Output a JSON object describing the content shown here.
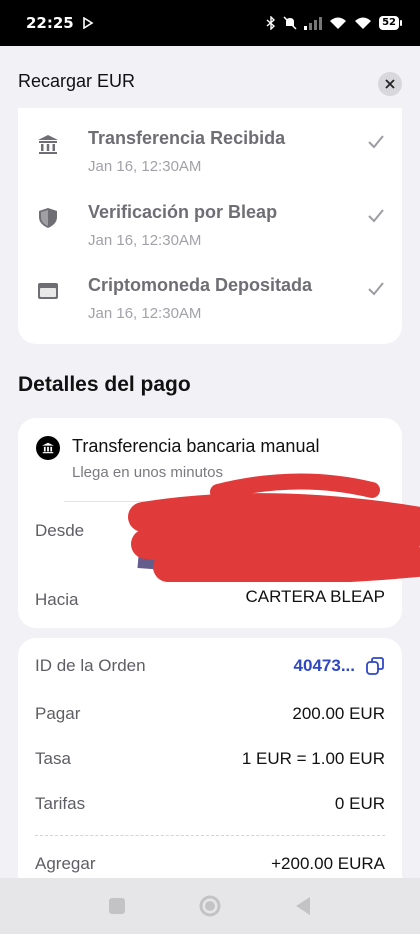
{
  "status_bar": {
    "time": "22:25",
    "battery": "52"
  },
  "header": {
    "title": "Recargar EUR"
  },
  "steps": [
    {
      "title": "Transferencia Recibida",
      "time": "Jan 16, 12:30AM",
      "icon": "bank-icon"
    },
    {
      "title": "Verificación por Bleap",
      "time": "Jan 16, 12:30AM",
      "icon": "shield-icon"
    },
    {
      "title": "Criptomoneda Depositada",
      "time": "Jan 16, 12:30AM",
      "icon": "wallet-icon"
    }
  ],
  "payment": {
    "section_title": "Detalles del pago",
    "method": "Transferencia bancaria manual",
    "method_sub": "Llega en unos minutos",
    "from_label": "Desde",
    "to_label": "Hacia",
    "to_value": "CARTERA BLEAP"
  },
  "order": {
    "id_label": "ID de la Orden",
    "id_value": "40473...",
    "pay_label": "Pagar",
    "pay_value": "200.00 EUR",
    "rate_label": "Tasa",
    "rate_value": "1 EUR = 1.00 EUR",
    "fees_label": "Tarifas",
    "fees_value": "0 EUR",
    "add_label": "Agregar",
    "add_value": "+200.00 EURA"
  },
  "colors": {
    "accent": "#2f48c4",
    "redaction": "#e03a3a"
  }
}
